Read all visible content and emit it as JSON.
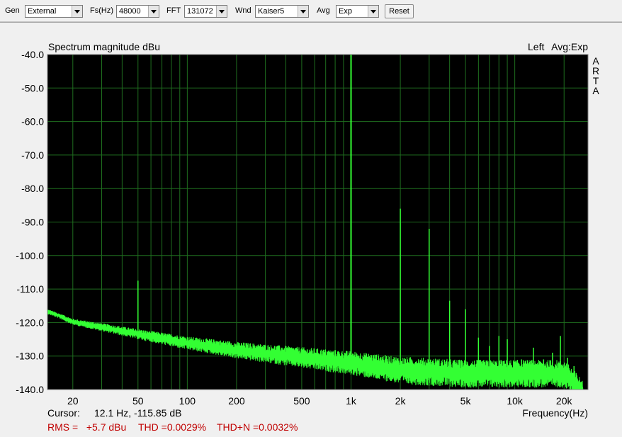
{
  "toolbar": {
    "gen_label": "Gen",
    "gen_value": "External",
    "fs_label": "Fs(Hz)",
    "fs_value": "48000",
    "fft_label": "FFT",
    "fft_value": "131072",
    "wnd_label": "Wnd",
    "wnd_value": "Kaiser5",
    "avg_label": "Avg",
    "avg_value": "Exp",
    "reset_label": "Reset"
  },
  "colors": {
    "plot_bg": "#000000",
    "grid": "#1f6e1f",
    "trace": "#33ff33",
    "stats": "#c00000"
  },
  "chart_data": {
    "type": "line",
    "title": "Spectrum magnitude dBu",
    "channel_label": "Left",
    "avg_label": "Avg:Exp",
    "brand": [
      "A",
      "R",
      "T",
      "A"
    ],
    "xlabel": "Frequency(Hz)",
    "x_scale": "log",
    "xlim": [
      14,
      28000
    ],
    "ylim": [
      -140,
      -40
    ],
    "grid": true,
    "y_ticks": [
      "-40.0",
      "-50.0",
      "-60.0",
      "-70.0",
      "-80.0",
      "-90.0",
      "-100.0",
      "-110.0",
      "-120.0",
      "-130.0",
      "-140.0"
    ],
    "x_tick_values": [
      20,
      50,
      100,
      200,
      500,
      1000,
      2000,
      5000,
      10000,
      20000
    ],
    "x_tick_labels": [
      "20",
      "50",
      "100",
      "200",
      "500",
      "1k",
      "2k",
      "5k",
      "10k",
      "20k"
    ],
    "noise_floor": [
      [
        14,
        -116.5
      ],
      [
        17,
        -118
      ],
      [
        20,
        -119.5
      ],
      [
        30,
        -121
      ],
      [
        50,
        -123
      ],
      [
        100,
        -125.5
      ],
      [
        200,
        -127.5
      ],
      [
        500,
        -129.5
      ],
      [
        1000,
        -131
      ],
      [
        2000,
        -133
      ],
      [
        5000,
        -134
      ],
      [
        10000,
        -134
      ],
      [
        20000,
        -134
      ],
      [
        23000,
        -137
      ],
      [
        26000,
        -140
      ]
    ],
    "peaks": [
      {
        "freq": 50,
        "level": -107.5
      },
      {
        "freq": 150,
        "level": -125.5
      },
      {
        "freq": 1000,
        "level": -40
      },
      {
        "freq": 2000,
        "level": -86
      },
      {
        "freq": 3000,
        "level": -92
      },
      {
        "freq": 4000,
        "level": -113.5
      },
      {
        "freq": 5000,
        "level": -116
      },
      {
        "freq": 6000,
        "level": -124.5
      },
      {
        "freq": 7000,
        "level": -127
      },
      {
        "freq": 8000,
        "level": -124
      },
      {
        "freq": 9000,
        "level": -125
      },
      {
        "freq": 11000,
        "level": -131
      },
      {
        "freq": 13000,
        "level": -127.5
      },
      {
        "freq": 15000,
        "level": -131
      },
      {
        "freq": 17000,
        "level": -129
      },
      {
        "freq": 19000,
        "level": -124
      },
      {
        "freq": 21000,
        "level": -130.5
      },
      {
        "freq": 23000,
        "level": -133
      }
    ]
  },
  "cursor": {
    "label": "Cursor:",
    "value": "12.1 Hz, -115.85 dB"
  },
  "stats": {
    "rms": "RMS =   +5.7 dBu",
    "thd": "THD =0.0029%",
    "thdn": "THD+N =0.0032%"
  }
}
